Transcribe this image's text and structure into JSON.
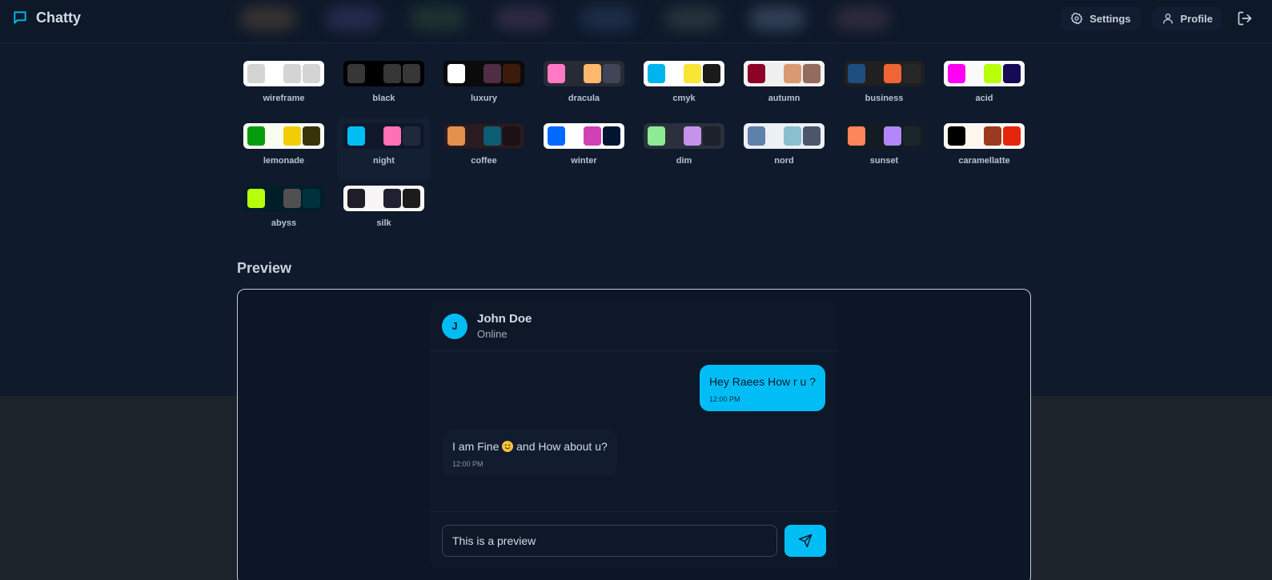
{
  "app": {
    "title": "Chatty"
  },
  "nav": {
    "settings_label": "Settings",
    "profile_label": "Profile"
  },
  "themes": [
    {
      "name": "wireframe",
      "colors": [
        "#d4d4d4",
        "#ffffff",
        "#d4d4d4",
        "#d4d4d4"
      ],
      "frame": "#ffffff"
    },
    {
      "name": "black",
      "colors": [
        "#373737",
        "#000000",
        "#373737",
        "#373737"
      ],
      "frame": "#000000"
    },
    {
      "name": "luxury",
      "colors": [
        "#ffffff",
        "#0b0b0b",
        "#4f2d45",
        "#3d1a0c"
      ],
      "frame": "#090909"
    },
    {
      "name": "dracula",
      "colors": [
        "#ff79c6",
        "#282a36",
        "#ffb86c",
        "#414558"
      ],
      "frame": "#282a36"
    },
    {
      "name": "cmyk",
      "colors": [
        "#00b4ee",
        "#ffffff",
        "#f8e535",
        "#1a1a1a"
      ],
      "frame": "#ffffff"
    },
    {
      "name": "autumn",
      "colors": [
        "#8c0327",
        "#f0f0f0",
        "#d99a72",
        "#936c5f"
      ],
      "frame": "#ffffff"
    },
    {
      "name": "business",
      "colors": [
        "#1c4e80",
        "#202020",
        "#f06535",
        "#272727"
      ],
      "frame": "#1e1e1e"
    },
    {
      "name": "acid",
      "colors": [
        "#ff00f2",
        "#fafafa",
        "#b8ff0a",
        "#150a56"
      ],
      "frame": "#ffffff"
    },
    {
      "name": "lemonade",
      "colors": [
        "#069c0b",
        "#f8fdef",
        "#f0cd05",
        "#39330a"
      ],
      "frame": "#ffffff"
    },
    {
      "name": "night",
      "colors": [
        "#00bdf4",
        "#0f1729",
        "#ff71b6",
        "#1e293b"
      ],
      "frame": "#0f1729"
    },
    {
      "name": "coffee",
      "colors": [
        "#e3914d",
        "#2b1c22",
        "#0a5d73",
        "#1b1015"
      ],
      "frame": "#221820"
    },
    {
      "name": "winter",
      "colors": [
        "#0069ff",
        "#ffffff",
        "#d140b5",
        "#021431"
      ],
      "frame": "#ffffff"
    },
    {
      "name": "dim",
      "colors": [
        "#8deb94",
        "#2a303c",
        "#c792e9",
        "#1c212b"
      ],
      "frame": "#2a303c"
    },
    {
      "name": "nord",
      "colors": [
        "#5e81ac",
        "#eceff4",
        "#88c0d0",
        "#4c566a"
      ],
      "frame": "#eceff4"
    },
    {
      "name": "sunset",
      "colors": [
        "#ff865b",
        "#121c22",
        "#b387fa",
        "#1b262c"
      ],
      "frame": "#121c22"
    },
    {
      "name": "caramellatte",
      "colors": [
        "#000000",
        "#fff7ed",
        "#9c3a20",
        "#e5260d"
      ],
      "frame": "#ffffff"
    },
    {
      "name": "abyss",
      "colors": [
        "#b7ff0a",
        "#001e29",
        "#505050",
        "#00323e"
      ],
      "frame": "#001e29"
    },
    {
      "name": "silk",
      "colors": [
        "#1e1e28",
        "#f7f5f3",
        "#202032",
        "#1c1c1c"
      ],
      "frame": "#ffffff"
    }
  ],
  "active_theme": "night",
  "preview": {
    "heading": "Preview",
    "contact": {
      "initial": "J",
      "name": "John Doe",
      "status": "Online"
    },
    "messages": [
      {
        "text": "Hey Raees How r u ?",
        "time": "12:00 PM",
        "sent": true
      },
      {
        "text_before": "I am Fine",
        "emoji": "slightly-smiling-face",
        "text_after": "and How about u?",
        "time": "12:00 PM",
        "sent": false
      }
    ],
    "input_value": "This is a preview"
  },
  "colors": {
    "accent": "#00bef5",
    "background": "#0f1a2c",
    "bottom_band": "#1d232a"
  }
}
